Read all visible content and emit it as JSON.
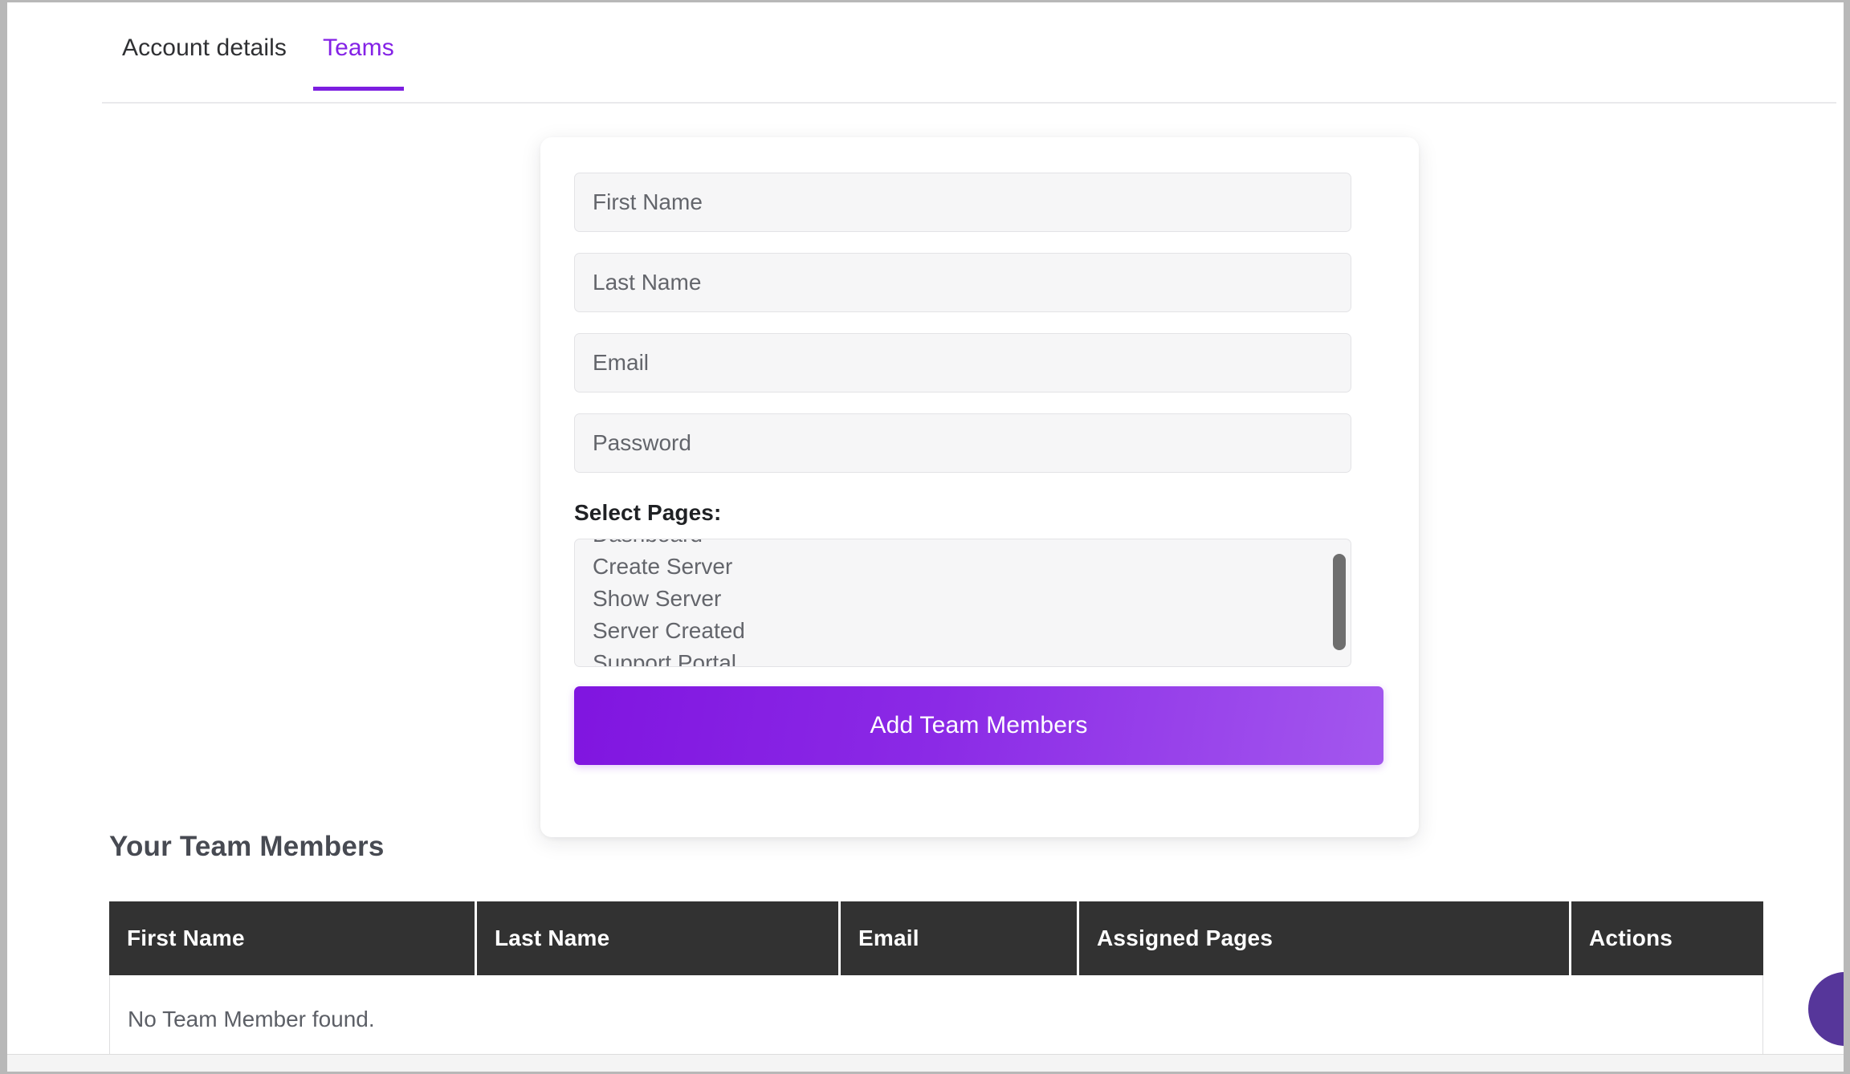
{
  "tabs": [
    {
      "label": "Account details",
      "active": false
    },
    {
      "label": "Teams",
      "active": true
    }
  ],
  "form": {
    "fields": [
      {
        "name": "first-name",
        "placeholder": "First Name",
        "value": ""
      },
      {
        "name": "last-name",
        "placeholder": "Last Name",
        "value": ""
      },
      {
        "name": "email",
        "placeholder": "Email",
        "value": ""
      },
      {
        "name": "password",
        "placeholder": "Password",
        "value": ""
      }
    ],
    "select_pages_label": "Select Pages:",
    "pages": [
      "Dashboard",
      "Create Server",
      "Show Server",
      "Server Created",
      "Support Portal"
    ],
    "submit_label": "Add Team Members"
  },
  "members": {
    "title": "Your Team Members",
    "columns": [
      "First Name",
      "Last Name",
      "Email",
      "Assigned Pages",
      "Actions"
    ],
    "empty_message": "No Team Member found."
  },
  "colors": {
    "accent_purple": "#7c1ee0",
    "tab_active_text": "#8422e6",
    "button_gradient_start": "#8015e0",
    "button_gradient_end": "#a357ee",
    "table_header_bg": "#323232",
    "field_bg": "#f6f6f7",
    "scrollbar_thumb": "#6e6e6e",
    "chat_bubble": "#56369a"
  }
}
